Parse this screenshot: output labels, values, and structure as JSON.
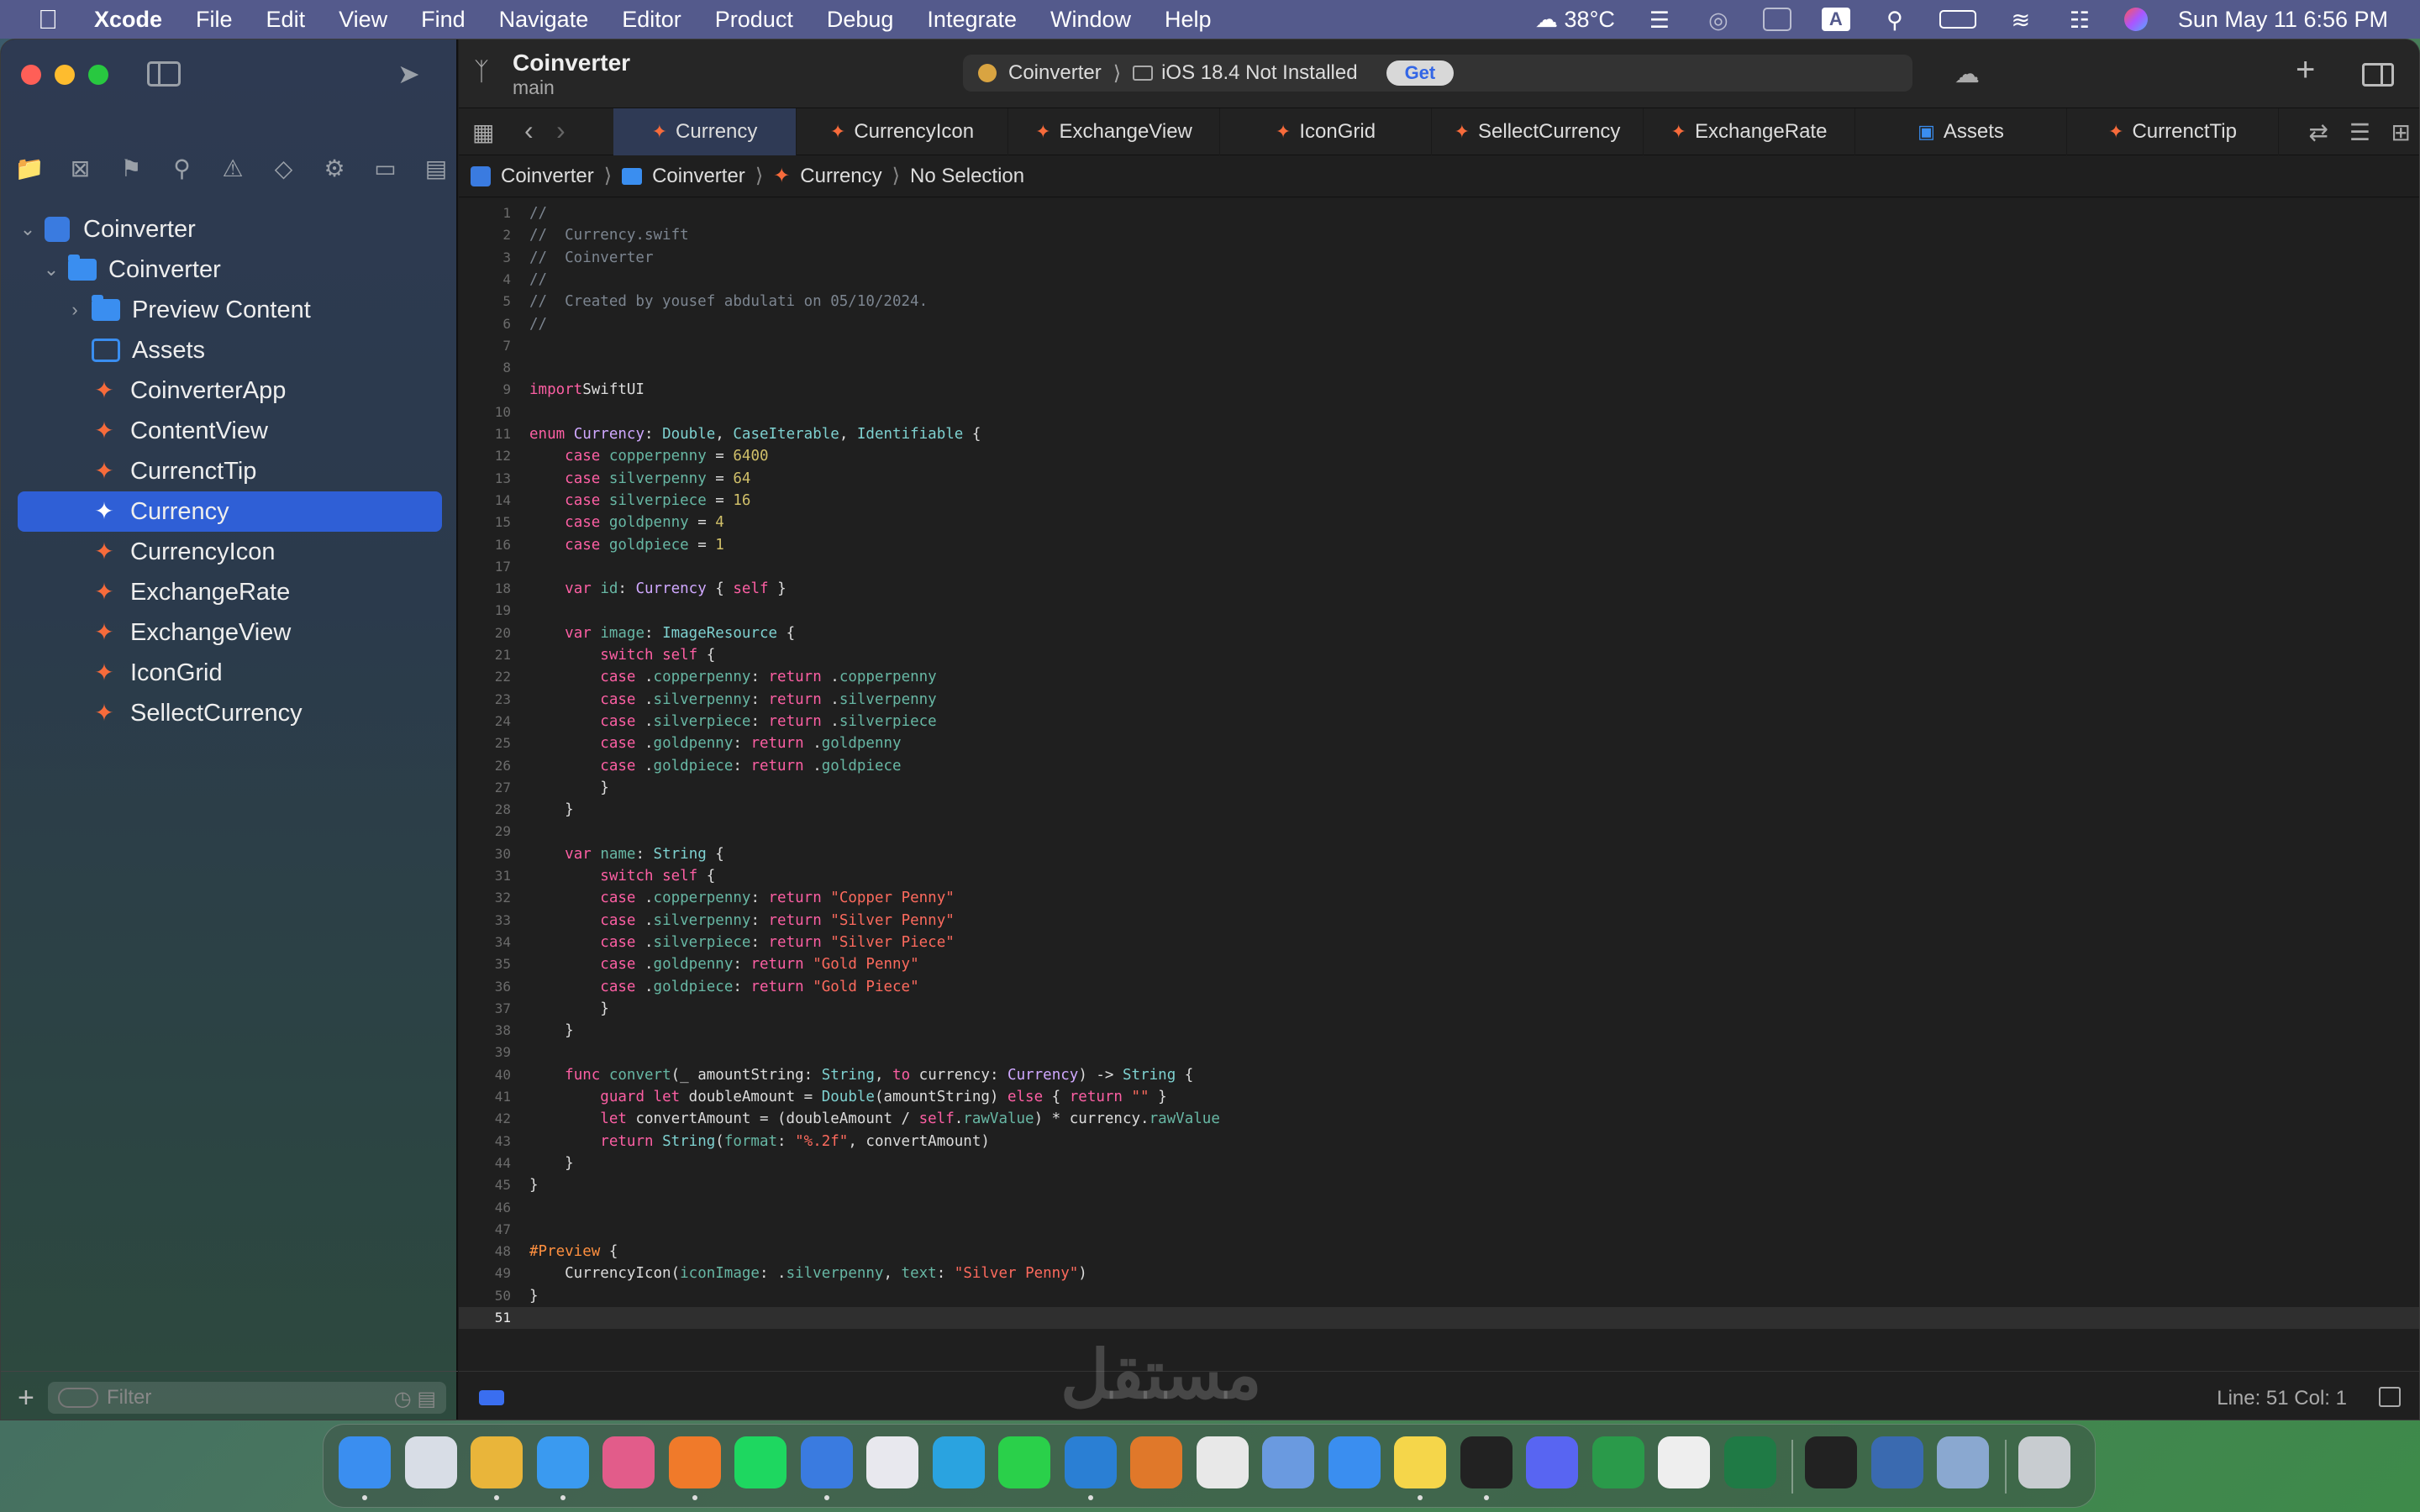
{
  "menubar": {
    "app_name": "Xcode",
    "items": [
      "File",
      "Edit",
      "View",
      "Find",
      "Navigate",
      "Editor",
      "Product",
      "Debug",
      "Integrate",
      "Window",
      "Help"
    ],
    "weather": "38°C",
    "input_source": "A",
    "datetime": "Sun May 11  6:56 PM"
  },
  "toolbar": {
    "project_name": "Coinverter",
    "branch": "main",
    "scheme_target": "Coinverter",
    "destination": "iOS 18.4 Not Installed",
    "get_label": "Get"
  },
  "navigator": {
    "items": [
      {
        "label": "Coinverter",
        "kind": "project",
        "indent": 0,
        "expanded": true
      },
      {
        "label": "Coinverter",
        "kind": "folder",
        "indent": 1,
        "expanded": true
      },
      {
        "label": "Preview Content",
        "kind": "folder",
        "indent": 2,
        "expanded": false
      },
      {
        "label": "Assets",
        "kind": "assets",
        "indent": 2
      },
      {
        "label": "CoinverterApp",
        "kind": "swift",
        "indent": 2
      },
      {
        "label": "ContentView",
        "kind": "swift",
        "indent": 2
      },
      {
        "label": "CurrenctTip",
        "kind": "swift",
        "indent": 2
      },
      {
        "label": "Currency",
        "kind": "swift",
        "indent": 2,
        "selected": true
      },
      {
        "label": "CurrencyIcon",
        "kind": "swift",
        "indent": 2
      },
      {
        "label": "ExchangeRate",
        "kind": "swift",
        "indent": 2
      },
      {
        "label": "ExchangeView",
        "kind": "swift",
        "indent": 2
      },
      {
        "label": "IconGrid",
        "kind": "swift",
        "indent": 2
      },
      {
        "label": "SellectCurrency",
        "kind": "swift",
        "indent": 2
      }
    ],
    "filter_placeholder": "Filter"
  },
  "tabs": [
    {
      "label": "Currency",
      "kind": "swift",
      "active": true
    },
    {
      "label": "CurrencyIcon",
      "kind": "swift"
    },
    {
      "label": "ExchangeView",
      "kind": "swift"
    },
    {
      "label": "IconGrid",
      "kind": "swift"
    },
    {
      "label": "SellectCurrency",
      "kind": "swift"
    },
    {
      "label": "ExchangeRate",
      "kind": "swift"
    },
    {
      "label": "Assets",
      "kind": "assets"
    },
    {
      "label": "CurrenctTip",
      "kind": "swift"
    }
  ],
  "jumpbar": {
    "project": "Coinverter",
    "group": "Coinverter",
    "file": "Currency",
    "symbol": "No Selection"
  },
  "editor": {
    "current_line": 51,
    "lines": [
      [
        [
          "c",
          "//"
        ]
      ],
      [
        [
          "c",
          "//  Currency.swift"
        ]
      ],
      [
        [
          "c",
          "//  Coinverter"
        ]
      ],
      [
        [
          "c",
          "//"
        ]
      ],
      [
        [
          "c",
          "//  Created by yousef abdulati on 05/10/2024."
        ]
      ],
      [
        [
          "c",
          "//"
        ]
      ],
      [],
      [],
      [
        [
          "k",
          "import"
        ],
        [
          "",
          "SwiftUI"
        ]
      ],
      [],
      [
        [
          "k",
          "enum"
        ],
        [
          "",
          " "
        ],
        [
          "t",
          "Currency"
        ],
        [
          "",
          ": "
        ],
        [
          "ty",
          "Double"
        ],
        [
          "",
          ", "
        ],
        [
          "ty",
          "CaseIterable"
        ],
        [
          "",
          ", "
        ],
        [
          "ty",
          "Identifiable"
        ],
        [
          "",
          " {"
        ]
      ],
      [
        [
          "",
          " "
        ],
        [
          "k",
          "case"
        ],
        [
          "",
          " "
        ],
        [
          "p",
          "copperpenny"
        ],
        [
          "",
          " = "
        ],
        [
          "n",
          "6400"
        ]
      ],
      [
        [
          "",
          " "
        ],
        [
          "k",
          "case"
        ],
        [
          "",
          " "
        ],
        [
          "p",
          "silverpenny"
        ],
        [
          "",
          " = "
        ],
        [
          "n",
          "64"
        ]
      ],
      [
        [
          "",
          " "
        ],
        [
          "k",
          "case"
        ],
        [
          "",
          " "
        ],
        [
          "p",
          "silverpiece"
        ],
        [
          "",
          " = "
        ],
        [
          "n",
          "16"
        ]
      ],
      [
        [
          "",
          " "
        ],
        [
          "k",
          "case"
        ],
        [
          "",
          " "
        ],
        [
          "p",
          "goldpenny"
        ],
        [
          "",
          " = "
        ],
        [
          "n",
          "4"
        ]
      ],
      [
        [
          "",
          " "
        ],
        [
          "k",
          "case"
        ],
        [
          "",
          " "
        ],
        [
          "p",
          "goldpiece"
        ],
        [
          "",
          " = "
        ],
        [
          "n",
          "1"
        ]
      ],
      [],
      [
        [
          "",
          " "
        ],
        [
          "k",
          "var"
        ],
        [
          "",
          " "
        ],
        [
          "p",
          "id"
        ],
        [
          "",
          ": "
        ],
        [
          "t",
          "Currency"
        ],
        [
          "",
          " { "
        ],
        [
          "k",
          "self"
        ],
        [
          "",
          " }"
        ]
      ],
      [],
      [
        [
          "",
          " "
        ],
        [
          "k",
          "var"
        ],
        [
          "",
          " "
        ],
        [
          "p",
          "image"
        ],
        [
          "",
          ": "
        ],
        [
          "ty",
          "ImageResource"
        ],
        [
          "",
          " {"
        ]
      ],
      [
        [
          "",
          " "
        ],
        [
          "k",
          "switch"
        ],
        [
          "",
          " "
        ],
        [
          "k",
          "self"
        ],
        [
          "",
          " {"
        ]
      ],
      [
        [
          "",
          " "
        ],
        [
          "k",
          "case"
        ],
        [
          "",
          " ."
        ],
        [
          "p",
          "copperpenny"
        ],
        [
          "",
          ": "
        ],
        [
          "k",
          "return"
        ],
        [
          "",
          " ."
        ],
        [
          "p",
          "copperpenny"
        ]
      ],
      [
        [
          "",
          " "
        ],
        [
          "k",
          "case"
        ],
        [
          "",
          " ."
        ],
        [
          "p",
          "silverpenny"
        ],
        [
          "",
          ": "
        ],
        [
          "k",
          "return"
        ],
        [
          "",
          " ."
        ],
        [
          "p",
          "silverpenny"
        ]
      ],
      [
        [
          "",
          " "
        ],
        [
          "k",
          "case"
        ],
        [
          "",
          " ."
        ],
        [
          "p",
          "silverpiece"
        ],
        [
          "",
          ": "
        ],
        [
          "k",
          "return"
        ],
        [
          "",
          " ."
        ],
        [
          "p",
          "silverpiece"
        ]
      ],
      [
        [
          "",
          " "
        ],
        [
          "k",
          "case"
        ],
        [
          "",
          " ."
        ],
        [
          "p",
          "goldpenny"
        ],
        [
          "",
          ": "
        ],
        [
          "k",
          "return"
        ],
        [
          "",
          " ."
        ],
        [
          "p",
          "goldpenny"
        ]
      ],
      [
        [
          "",
          " "
        ],
        [
          "k",
          "case"
        ],
        [
          "",
          " ."
        ],
        [
          "p",
          "goldpiece"
        ],
        [
          "",
          ": "
        ],
        [
          "k",
          "return"
        ],
        [
          "",
          " ."
        ],
        [
          "p",
          "goldpiece"
        ]
      ],
      [
        [
          "",
          " }"
        ]
      ],
      [
        [
          "",
          " }"
        ]
      ],
      [],
      [
        [
          "",
          " "
        ],
        [
          "k",
          "var"
        ],
        [
          "",
          " "
        ],
        [
          "p",
          "name"
        ],
        [
          "",
          ": "
        ],
        [
          "ty",
          "String"
        ],
        [
          "",
          " {"
        ]
      ],
      [
        [
          "",
          " "
        ],
        [
          "k",
          "switch"
        ],
        [
          "",
          " "
        ],
        [
          "k",
          "self"
        ],
        [
          "",
          " {"
        ]
      ],
      [
        [
          "",
          " "
        ],
        [
          "k",
          "case"
        ],
        [
          "",
          " ."
        ],
        [
          "p",
          "copperpenny"
        ],
        [
          "",
          ": "
        ],
        [
          "k",
          "return"
        ],
        [
          "",
          " "
        ],
        [
          "s",
          "\"Copper Penny\""
        ]
      ],
      [
        [
          "",
          " "
        ],
        [
          "k",
          "case"
        ],
        [
          "",
          " ."
        ],
        [
          "p",
          "silverpenny"
        ],
        [
          "",
          ": "
        ],
        [
          "k",
          "return"
        ],
        [
          "",
          " "
        ],
        [
          "s",
          "\"Silver Penny\""
        ]
      ],
      [
        [
          "",
          " "
        ],
        [
          "k",
          "case"
        ],
        [
          "",
          " ."
        ],
        [
          "p",
          "silverpiece"
        ],
        [
          "",
          ": "
        ],
        [
          "k",
          "return"
        ],
        [
          "",
          " "
        ],
        [
          "s",
          "\"Silver Piece\""
        ]
      ],
      [
        [
          "",
          " "
        ],
        [
          "k",
          "case"
        ],
        [
          "",
          " ."
        ],
        [
          "p",
          "goldpenny"
        ],
        [
          "",
          ": "
        ],
        [
          "k",
          "return"
        ],
        [
          "",
          " "
        ],
        [
          "s",
          "\"Gold Penny\""
        ]
      ],
      [
        [
          "",
          " "
        ],
        [
          "k",
          "case"
        ],
        [
          "",
          " ."
        ],
        [
          "p",
          "goldpiece"
        ],
        [
          "",
          ": "
        ],
        [
          "k",
          "return"
        ],
        [
          "",
          " "
        ],
        [
          "s",
          "\"Gold Piece\""
        ]
      ],
      [
        [
          "",
          " }"
        ]
      ],
      [
        [
          "",
          " }"
        ]
      ],
      [],
      [
        [
          "",
          " "
        ],
        [
          "k",
          "func"
        ],
        [
          "",
          " "
        ],
        [
          "p",
          "convert"
        ],
        [
          "",
          "(_ "
        ],
        [
          "",
          "amountString"
        ],
        [
          "",
          ": "
        ],
        [
          "ty",
          "String"
        ],
        [
          "",
          ", "
        ],
        [
          "k",
          "to"
        ],
        [
          "",
          " currency: "
        ],
        [
          "t",
          "Currency"
        ],
        [
          "",
          ") -> "
        ],
        [
          "ty",
          "String"
        ],
        [
          "",
          " {"
        ]
      ],
      [
        [
          "",
          " "
        ],
        [
          "k",
          "guard"
        ],
        [
          "",
          " "
        ],
        [
          "k",
          "let"
        ],
        [
          "",
          " doubleAmount = "
        ],
        [
          "ty",
          "Double"
        ],
        [
          "",
          "(amountString) "
        ],
        [
          "k",
          "else"
        ],
        [
          "",
          " { "
        ],
        [
          "k",
          "return"
        ],
        [
          "",
          " "
        ],
        [
          "s",
          "\"\""
        ],
        [
          "",
          " }"
        ]
      ],
      [
        [
          "",
          " "
        ],
        [
          "k",
          "let"
        ],
        [
          "",
          " convertAmount = (doubleAmount / "
        ],
        [
          "k",
          "self"
        ],
        [
          "",
          "."
        ],
        [
          "p",
          "rawValue"
        ],
        [
          "",
          ") * currency."
        ],
        [
          "p",
          "rawValue"
        ]
      ],
      [
        [
          "",
          " "
        ],
        [
          "k",
          "return"
        ],
        [
          "",
          " "
        ],
        [
          "ty",
          "String"
        ],
        [
          "",
          "("
        ],
        [
          "p",
          "format"
        ],
        [
          "",
          ": "
        ],
        [
          "s",
          "\"%.2f\""
        ],
        [
          "",
          ", convertAmount)"
        ]
      ],
      [
        [
          "",
          " }"
        ]
      ],
      [
        [
          "",
          "}"
        ]
      ],
      [],
      [],
      [
        [
          "ex",
          "#Preview"
        ],
        [
          "",
          " {"
        ]
      ],
      [
        [
          "",
          " CurrencyIcon("
        ],
        [
          "p",
          "iconImage"
        ],
        [
          "",
          ": ."
        ],
        [
          "p",
          "silverpenny"
        ],
        [
          "",
          ", "
        ],
        [
          "p",
          "text"
        ],
        [
          "",
          ": "
        ],
        [
          "s",
          "\"Silver Penny\""
        ],
        [
          "",
          ")"
        ]
      ],
      [
        [
          "",
          "}"
        ]
      ],
      []
    ]
  },
  "status": {
    "position": "Line: 51  Col: 1"
  },
  "watermark": "مستقل"
}
